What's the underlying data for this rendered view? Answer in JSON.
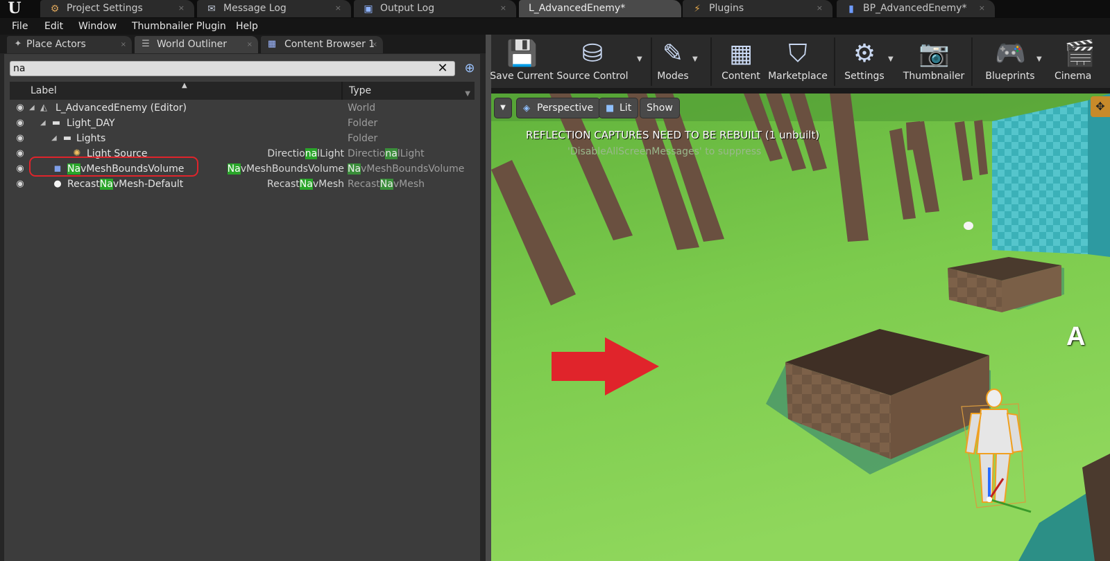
{
  "app": {
    "logo_glyph": "U"
  },
  "doc_tabs": [
    {
      "label": "Project Settings",
      "icon": "settings-icon",
      "glyph": "⚙"
    },
    {
      "label": "Message Log",
      "icon": "chat-icon",
      "glyph": "✉"
    },
    {
      "label": "Output Log",
      "icon": "console-icon",
      "glyph": "▣"
    },
    {
      "label": "L_AdvancedEnemy*",
      "icon": "level-icon",
      "glyph": ""
    },
    {
      "label": "Plugins",
      "icon": "plug-icon",
      "glyph": "⚡"
    },
    {
      "label": "BP_AdvancedEnemy*",
      "icon": "blueprint-icon",
      "glyph": "▮"
    }
  ],
  "tab_close_glyph": "×",
  "menu": [
    "File",
    "Edit",
    "Window",
    "Thumbnailer Plugin",
    "Help"
  ],
  "panel_tabs": [
    {
      "label": "Place Actors",
      "icon": "place-actors-icon",
      "glyph": "✦"
    },
    {
      "label": "World Outliner",
      "icon": "outliner-icon",
      "glyph": "☰"
    },
    {
      "label": "Content Browser 1",
      "icon": "content-browser-icon",
      "glyph": "▦"
    }
  ],
  "search": {
    "value": "na",
    "placeholder": ""
  },
  "columns": {
    "label": "Label",
    "type": "Type"
  },
  "rows": [
    {
      "pre": "L_AdvancedEnemy (Editor)",
      "match": "",
      "post": "",
      "actor_pre": "",
      "actor_match": "",
      "actor_post": "",
      "type_pre": "World",
      "type_match": "",
      "type_post": "",
      "icon": "world-icon",
      "glyph": "◭"
    },
    {
      "pre": "Light_DAY",
      "match": "",
      "post": "",
      "actor_pre": "",
      "actor_match": "",
      "actor_post": "",
      "type_pre": "Folder",
      "type_match": "",
      "type_post": "",
      "icon": "folder-icon",
      "glyph": "▬"
    },
    {
      "pre": "Lights",
      "match": "",
      "post": "",
      "actor_pre": "",
      "actor_match": "",
      "actor_post": "",
      "type_pre": "Folder",
      "type_match": "",
      "type_post": "",
      "icon": "folder-icon",
      "glyph": "▬"
    },
    {
      "pre": "Light Source",
      "match": "",
      "post": "",
      "actor_pre": "Directio",
      "actor_match": "na",
      "actor_post": "lLight",
      "type_pre": "Directio",
      "type_match": "na",
      "type_post": "lLight",
      "icon": "directional-light-icon",
      "glyph": "✺"
    },
    {
      "pre": "",
      "match": "Na",
      "post": "vMeshBoundsVolume",
      "actor_pre": "",
      "actor_match": "Na",
      "actor_post": "vMeshBoundsVolume",
      "type_pre": "",
      "type_match": "Na",
      "type_post": "vMeshBoundsVolume",
      "icon": "volume-icon",
      "glyph": "◼"
    },
    {
      "pre": "Recast",
      "match": "Na",
      "post": "vMesh-Default",
      "actor_pre": "Recast",
      "actor_match": "Na",
      "actor_post": "vMesh",
      "type_pre": "Recast",
      "type_match": "Na",
      "type_post": "vMesh",
      "icon": "sphere-icon",
      "glyph": "●"
    }
  ],
  "toolbar": [
    {
      "label": "Save Current",
      "icon": "save-icon",
      "glyph": "💾",
      "dropdown": false
    },
    {
      "label": "Source Control",
      "icon": "source-control-icon",
      "glyph": "⛁",
      "dropdown": true
    },
    {
      "label": "Modes",
      "icon": "modes-icon",
      "glyph": "✎",
      "dropdown": true
    },
    {
      "label": "Content",
      "icon": "content-icon",
      "glyph": "▦",
      "dropdown": false
    },
    {
      "label": "Marketplace",
      "icon": "marketplace-icon",
      "glyph": "⛉",
      "dropdown": false
    },
    {
      "label": "Settings",
      "icon": "gear-icon",
      "glyph": "⚙",
      "dropdown": true
    },
    {
      "label": "Thumbnailer",
      "icon": "camera-icon",
      "glyph": "📷",
      "dropdown": false
    },
    {
      "label": "Blueprints",
      "icon": "gamepad-icon",
      "glyph": "🎮",
      "dropdown": true
    },
    {
      "label": "Cinema",
      "icon": "clapper-icon",
      "glyph": "🎬",
      "dropdown": false
    }
  ],
  "viewport": {
    "perspective_label": "Perspective",
    "lit_label": "Lit",
    "show_label": "Show",
    "message": "REFLECTION CAPTURES NEED TO BE REBUILT (1 unbuilt)",
    "suppress_hint": "'DisableAllScreenMessages' to suppress",
    "corner_glyph": "✥",
    "side_letter": "A"
  },
  "colors": {
    "ground": "#72c24a",
    "highlight": "#2aa52a",
    "annotation_red": "#e0242b"
  }
}
